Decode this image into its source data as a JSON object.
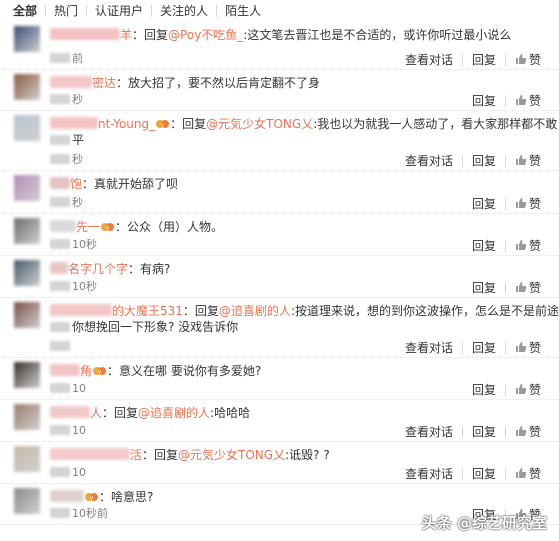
{
  "tabs": [
    "全部",
    "热门",
    "认证用户",
    "关注的人",
    "陌生人"
  ],
  "actions": {
    "view_conversation": "查看对话",
    "reply": "回复",
    "like": "赞"
  },
  "comments": [
    {
      "name_visible": "羊",
      "body": [
        {
          "t": "text",
          "v": "："
        },
        {
          "t": "text",
          "v": "回复"
        },
        {
          "t": "mention",
          "v": "@Poy不吃鱼_"
        },
        {
          "t": "text",
          "v": ":这文笔去晋江也是不合适的，或许你听过最小说么"
        }
      ],
      "body2": "",
      "time": "前",
      "has_vip": false,
      "has_view": true
    },
    {
      "name_visible": "密达",
      "body": [
        {
          "t": "text",
          "v": "：放大招了，要不然以后肯定翻不了身"
        }
      ],
      "body2": "",
      "time": "秒",
      "has_vip": false,
      "has_view": false
    },
    {
      "name_visible": "nt-Young_",
      "body": [
        {
          "t": "text",
          "v": "：回复"
        },
        {
          "t": "mention",
          "v": "@元気少女TONG乂"
        },
        {
          "t": "text",
          "v": ":我也以为就我一人感动了，看大家那样都不敢"
        }
      ],
      "body2": "平",
      "time": "秒",
      "has_vip": true,
      "has_view": true
    },
    {
      "name_visible": "饱",
      "body": [
        {
          "t": "text",
          "v": "：真就开始舔了呗"
        }
      ],
      "body2": "",
      "time": "秒",
      "has_vip": false,
      "has_view": false
    },
    {
      "name_visible": "先一",
      "body": [
        {
          "t": "text",
          "v": "：公众（用）人物。"
        }
      ],
      "body2": "",
      "time": "10秒",
      "has_vip": true,
      "has_view": false
    },
    {
      "name_visible": "名字几个字",
      "body": [
        {
          "t": "text",
          "v": "：有病?"
        }
      ],
      "body2": "",
      "time": "10秒",
      "has_vip": false,
      "has_view": false
    },
    {
      "name_visible": "的大魔王531",
      "body": [
        {
          "t": "text",
          "v": "：回复"
        },
        {
          "t": "mention",
          "v": "@追喜剧的人"
        },
        {
          "t": "text",
          "v": ":按道理来说，想的到你这波操作，怎么是不是前途受"
        }
      ],
      "body2": "你想挽回一下形象? 没戏告诉你",
      "time": "",
      "has_vip": false,
      "has_view": true
    },
    {
      "name_visible": "角",
      "body": [
        {
          "t": "text",
          "v": "：意义在哪 要说你有多爱她?"
        }
      ],
      "body2": "",
      "time": "10",
      "has_vip": true,
      "has_view": false
    },
    {
      "name_visible": "人",
      "body": [
        {
          "t": "text",
          "v": "：回复"
        },
        {
          "t": "mention",
          "v": "@追喜剧的人"
        },
        {
          "t": "text",
          "v": ":哈哈哈"
        }
      ],
      "body2": "",
      "time": "10",
      "has_vip": false,
      "has_view": true
    },
    {
      "name_visible": "活",
      "body": [
        {
          "t": "text",
          "v": "：回复"
        },
        {
          "t": "mention",
          "v": "@元気少女TONG乂"
        },
        {
          "t": "text",
          "v": ":诋毁? ?"
        }
      ],
      "body2": "",
      "time": "10",
      "has_vip": false,
      "has_view": true
    },
    {
      "name_visible": "",
      "body": [
        {
          "t": "text",
          "v": "：啥意思?"
        }
      ],
      "body2": "",
      "time": "10秒前",
      "has_vip": true,
      "has_view": false
    }
  ],
  "watermark": "头条 @综艺研究室",
  "colors": {
    "mention": "#eb7350",
    "accent_vip": "#f5a623"
  }
}
